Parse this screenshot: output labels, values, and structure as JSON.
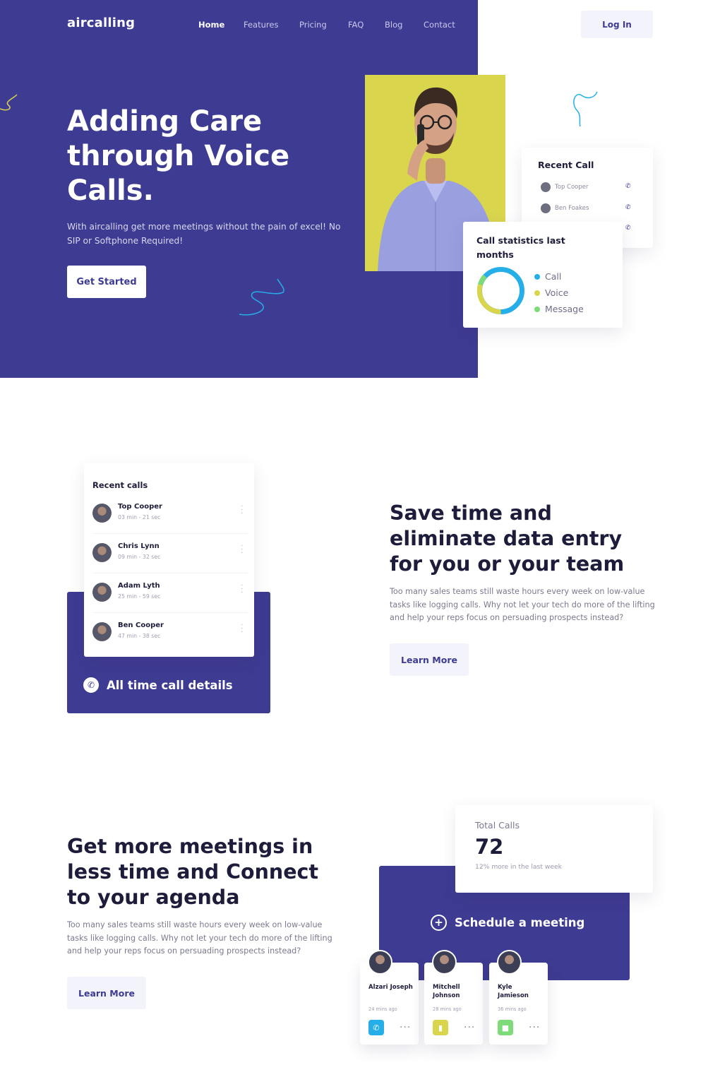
{
  "brand": {
    "logo": "aircalling",
    "primary": "#3e3b92",
    "accent_yellow": "#d9d54d",
    "accent_blue": "#25aee8",
    "accent_green": "#7ddb79"
  },
  "nav": {
    "items": [
      "Home",
      "Features",
      "Pricing",
      "FAQ",
      "Blog",
      "Contact"
    ],
    "active": "Home",
    "login": "Log In"
  },
  "hero": {
    "title": "Adding Care through Voice Calls.",
    "subtitle": "With aircalling get more meetings without the pain of excel! No SIP or Softphone Required!",
    "cta": "Get Started"
  },
  "recent_call_card": {
    "title": "Recent Call",
    "rows": [
      {
        "name": "Top Cooper",
        "icon": "phone-icon"
      },
      {
        "name": "Ben Foakes",
        "icon": "phone-icon"
      },
      {
        "name": "",
        "icon": "phone-icon"
      }
    ]
  },
  "stats_card": {
    "title": "Call statistics last months",
    "legend": [
      {
        "label": "Call",
        "color": "#25aee8"
      },
      {
        "label": "Voice",
        "color": "#d9d54d"
      },
      {
        "label": "Message",
        "color": "#7ddb79"
      }
    ]
  },
  "section2": {
    "calls_title": "Recent calls",
    "calls": [
      {
        "name": "Top Cooper",
        "duration": "03 min - 21 sec"
      },
      {
        "name": "Chris Lynn",
        "duration": "09 min - 32 sec"
      },
      {
        "name": "Adam Lyth",
        "duration": "25 min - 59 sec"
      },
      {
        "name": "Ben Cooper",
        "duration": "47 min - 38 sec"
      }
    ],
    "footer": "All time call details",
    "title": "Save time and eliminate data entry for you or your team",
    "text": "Too many sales teams still waste hours every week on low-value tasks like logging calls. Why not let your tech do more of the lifting and help your reps focus on persuading prospects instead?",
    "button": "Learn More"
  },
  "section3": {
    "title": "Get more meetings in less time and Connect to your agenda",
    "text": "Too many sales teams still waste hours every week on low-value tasks like logging calls. Why not let your tech do more of the lifting and help your reps focus on persuading prospects instead?",
    "button": "Learn More",
    "total": {
      "label": "Total Calls",
      "value": "72",
      "sub": "12% more in the last week"
    },
    "schedule": "Schedule a meeting",
    "people": [
      {
        "name": "Alzari Joseph",
        "time": "24 mins ago",
        "action": "phone-icon",
        "color": "#25aee8"
      },
      {
        "name": "Mitchell Johnson",
        "time": "28 mins ago",
        "action": "microphone-icon",
        "color": "#d9d54d"
      },
      {
        "name": "Kyle Jamieson",
        "time": "36 mins ago",
        "action": "message-icon",
        "color": "#7ddb79"
      }
    ]
  }
}
